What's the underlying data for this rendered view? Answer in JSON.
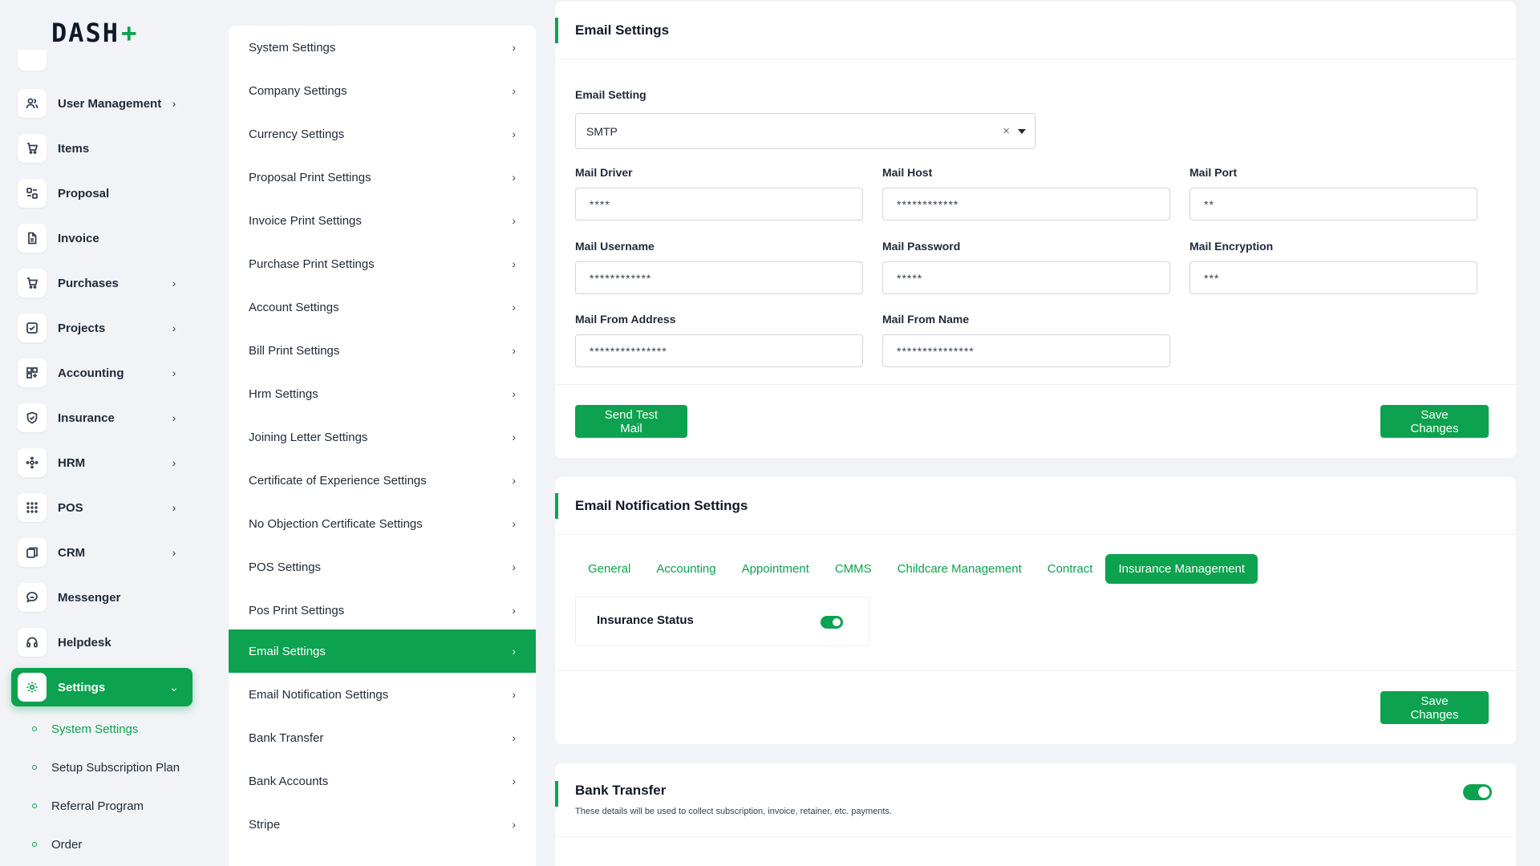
{
  "brand": {
    "logo_text": "DASH",
    "accent": "#0ca24f"
  },
  "sidebar": {
    "items": [
      {
        "label": "User Management",
        "icon": "users-icon",
        "chevron": true
      },
      {
        "label": "Items",
        "icon": "cart-icon",
        "chevron": false
      },
      {
        "label": "Proposal",
        "icon": "proposal-icon",
        "chevron": false
      },
      {
        "label": "Invoice",
        "icon": "file-icon",
        "chevron": false
      },
      {
        "label": "Purchases",
        "icon": "cart-icon",
        "chevron": true
      },
      {
        "label": "Projects",
        "icon": "check-square-icon",
        "chevron": true
      },
      {
        "label": "Accounting",
        "icon": "grid-icon",
        "chevron": true
      },
      {
        "label": "Insurance",
        "icon": "shield-icon",
        "chevron": true
      },
      {
        "label": "HRM",
        "icon": "hrm-icon",
        "chevron": true
      },
      {
        "label": "POS",
        "icon": "dots-grid-icon",
        "chevron": true
      },
      {
        "label": "CRM",
        "icon": "crm-icon",
        "chevron": true
      },
      {
        "label": "Messenger",
        "icon": "chat-icon",
        "chevron": false
      },
      {
        "label": "Helpdesk",
        "icon": "headset-icon",
        "chevron": false
      },
      {
        "label": "Settings",
        "icon": "gear-icon",
        "chevron": true,
        "active": true
      }
    ],
    "sub_items": [
      {
        "label": "System Settings",
        "current": true
      },
      {
        "label": "Setup Subscription Plan"
      },
      {
        "label": "Referral Program"
      },
      {
        "label": "Order"
      }
    ]
  },
  "settings_menu": {
    "items": [
      "System Settings",
      "Company Settings",
      "Currency Settings",
      "Proposal Print Settings",
      "Invoice Print Settings",
      "Purchase Print Settings",
      "Account Settings",
      "Bill Print Settings",
      "Hrm Settings",
      "Joining Letter Settings",
      "Certificate of Experience Settings",
      "No Objection Certificate Settings",
      "POS Settings",
      "Pos Print Settings",
      "Email Settings",
      "Email Notification Settings",
      "Bank Transfer",
      "Bank Accounts",
      "Stripe"
    ],
    "active": "Email Settings"
  },
  "email_settings": {
    "title": "Email Settings",
    "setting_label": "Email Setting",
    "setting_value": "SMTP",
    "clear_symbol": "×",
    "fields": {
      "mail_driver": {
        "label": "Mail Driver",
        "value": "****"
      },
      "mail_host": {
        "label": "Mail Host",
        "value": "************"
      },
      "mail_port": {
        "label": "Mail Port",
        "value": "**"
      },
      "mail_username": {
        "label": "Mail Username",
        "value": "************"
      },
      "mail_password": {
        "label": "Mail Password",
        "value": "*****"
      },
      "mail_encryption": {
        "label": "Mail Encryption",
        "value": "***"
      },
      "mail_from_address": {
        "label": "Mail From Address",
        "value": "***************"
      },
      "mail_from_name": {
        "label": "Mail From Name",
        "value": "***************"
      }
    },
    "send_test_label": "Send Test Mail",
    "save_label": "Save Changes"
  },
  "email_notification": {
    "title": "Email Notification Settings",
    "tabs": [
      "General",
      "Accounting",
      "Appointment",
      "CMMS",
      "Childcare Management",
      "Contract",
      "Insurance Management"
    ],
    "active_tab": "Insurance Management",
    "item_label": "Insurance Status",
    "item_enabled": true,
    "save_label": "Save Changes"
  },
  "bank_transfer": {
    "title": "Bank Transfer",
    "subtitle": "These details will be used to collect subscription, invoice, retainer, etc. payments.",
    "enabled": true
  }
}
